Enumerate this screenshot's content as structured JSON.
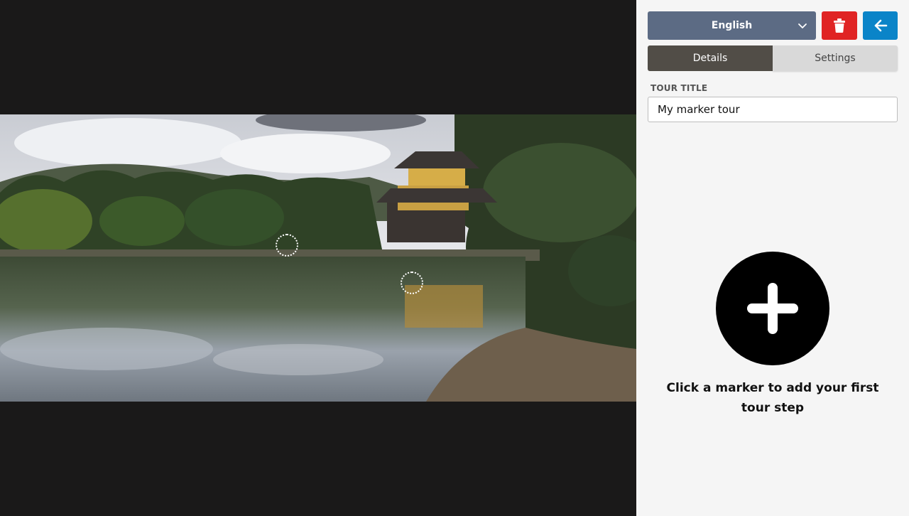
{
  "toolbar": {
    "language_label": "English",
    "language_chevron_icon": "chevron-down-icon",
    "delete_icon": "trash-icon",
    "back_icon": "arrow-left-icon",
    "colors": {
      "language": "#5c6b84",
      "delete": "#e02424",
      "back": "#0a84c8"
    }
  },
  "tabs": [
    {
      "label": "Details",
      "active": true
    },
    {
      "label": "Settings",
      "active": false
    }
  ],
  "form": {
    "title_label": "TOUR TITLE",
    "title_value": "My marker tour"
  },
  "empty_state": {
    "add_icon": "plus-icon",
    "message": "Click a marker to add your first tour step"
  },
  "viewer": {
    "markers_count": 2,
    "marker_icon": "marker-ring-icon"
  }
}
